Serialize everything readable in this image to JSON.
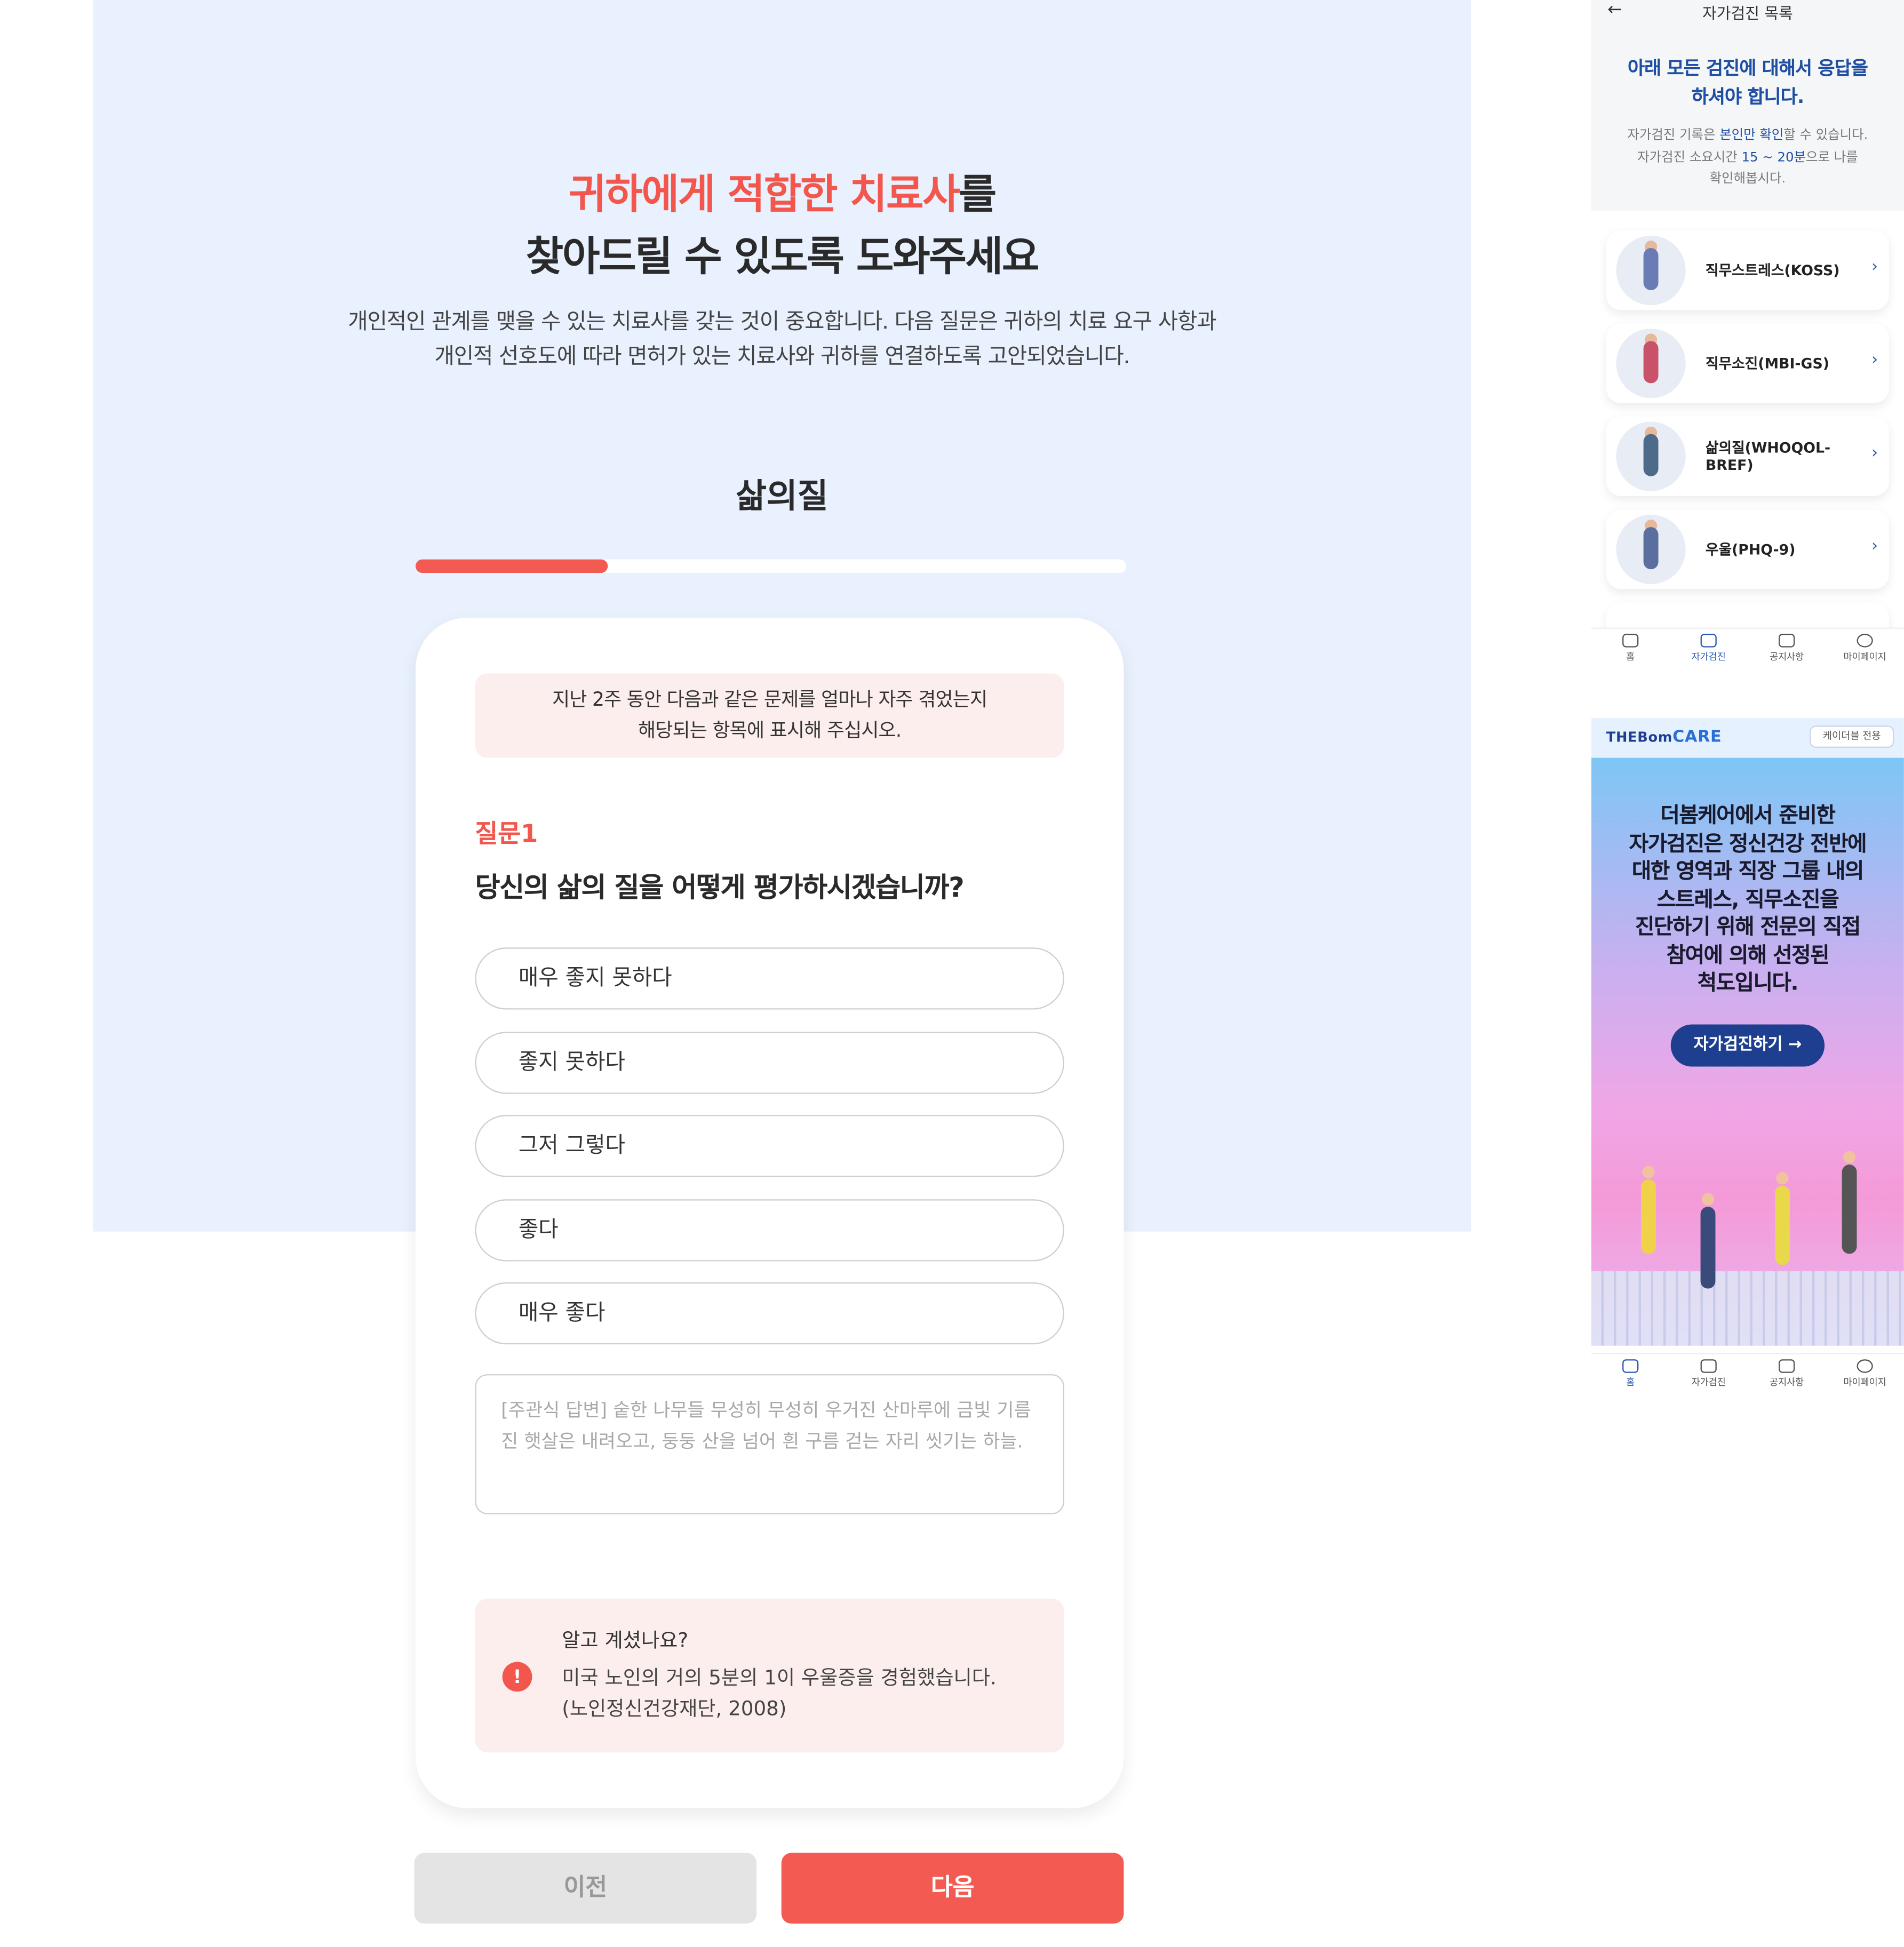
{
  "main": {
    "title_accent_1": "귀하에게",
    "title_accent_2": "적합한 치료사",
    "title_rest_1": "를",
    "title_line_2": "찾아드릴 수 있도록 도와주세요",
    "lead_line_1": "개인적인 관계를 맺을 수 있는 치료사를 갖는 것이 중요합니다. 다음 질문은 귀하의 치료 요구 사항과",
    "lead_line_2": "개인적 선호도에 따라 면허가 있는 치료사와 귀하를 연결하도록 고안되었습니다.",
    "section_title": "삶의질",
    "progress": 0.27,
    "notice_line_1": "지난 2주 동안 다음과 같은 문제를 얼마나 자주 겪었는지",
    "notice_line_2": "해당되는 항목에 표시해 주십시오.",
    "question_number": "질문1",
    "question_text": "당신의 삶의 질을 어떻게 평가하시겠습니까?",
    "options": [
      "매우 좋지 못하다",
      "좋지 못하다",
      "그저 그렇다",
      "좋다",
      "매우 좋다"
    ],
    "free_text": "[주관식 답변] 숱한 나무들 무성히 무성히 우거진 산마루에 금빛 기름진 햇살은 내려오고, 둥둥 산을 넘어 흰 구름 걷는 자리 씻기는 하늘.",
    "tip_title": "알고 계셨나요?",
    "tip_line_1": "미국 노인의 거의 5분의 1이 우울증을 경험했습니다.",
    "tip_line_2": "(노인정신건강재단, 2008)",
    "tip_icon": "!",
    "prev_label": "이전",
    "next_label": "다음",
    "accent_color": "#f25a52",
    "hero_bg_color": "#e8f1fd"
  },
  "phone1": {
    "back_icon": "←",
    "title": "자가검진 목록",
    "head_line_1": "아래 모든 검진에 대해서 응답을",
    "head_line_2": "하셔야 합니다.",
    "sub_line_1_a": "자가검진 기록은 ",
    "sub_line_1_hl": "본인만 확인",
    "sub_line_1_b": "할 수 있습니다.",
    "sub_line_2_a": "자가검진 소요시간 ",
    "sub_line_2_hl": "15 ~ 20분",
    "sub_line_2_b": "으로 나를",
    "sub_line_3": "확인해봅시다.",
    "items": [
      {
        "label": "직무스트레스(KOSS)"
      },
      {
        "label": "직무소진(MBI-GS)"
      },
      {
        "label": "삶의질(WHOQOL-BREF)"
      },
      {
        "label": "우울(PHQ-9)"
      }
    ],
    "chevron": "›",
    "tabs": [
      "홈",
      "자가검진",
      "공지사항",
      "마이페이지"
    ],
    "active_tab": 1
  },
  "phone2": {
    "logo_a": "THEBom",
    "logo_b": "CARE",
    "badge": "케이더블 전용",
    "banner_lines": [
      "더봄케어에서 준비한",
      "자가검진은 정신건강 전반에",
      "대한 영역과 직장 그룹 내의",
      "스트레스, 직무소진을",
      "진단하기 위해 전문의 직접",
      "참여에 의해 선정된",
      "척도입니다."
    ],
    "cta": "자가검진하기 →",
    "tabs": [
      "홈",
      "자가검진",
      "공지사항",
      "마이페이지"
    ],
    "active_tab": 0
  }
}
